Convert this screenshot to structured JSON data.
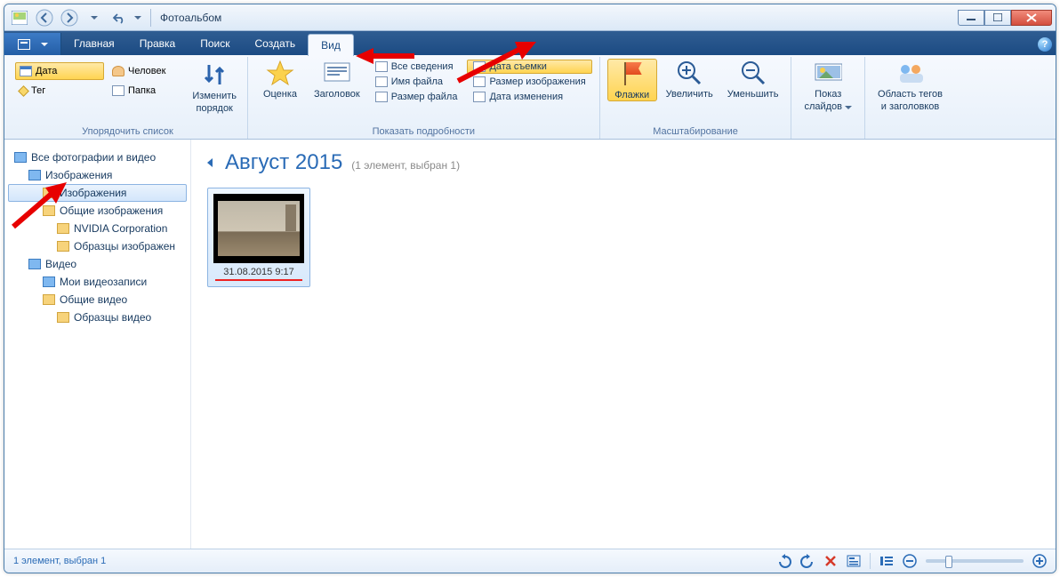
{
  "window": {
    "title": "Фотоальбом"
  },
  "tabs": {
    "file": "",
    "items": [
      "Главная",
      "Правка",
      "Поиск",
      "Создать",
      "Вид"
    ],
    "activeIndex": 4
  },
  "ribbon": {
    "sort": {
      "label": "Упорядочить список",
      "chips": {
        "date": "Дата",
        "tag": "Тег",
        "person": "Человек",
        "folder": "Папка"
      }
    },
    "change_order": {
      "line1": "Изменить",
      "line2": "порядок"
    },
    "rating_label": "Оценка",
    "caption_label": "Заголовок",
    "details": {
      "label": "Показать подробности",
      "all": "Все сведения",
      "filename": "Имя файла",
      "filesize": "Размер файла",
      "shot_date": "Дата съемки",
      "img_size": "Размер изображения",
      "modified": "Дата изменения"
    },
    "flags_label": "Флажки",
    "zoom_in": "Увеличить",
    "zoom_out": "Уменьшить",
    "zoom_label": "Масштабирование",
    "slideshow": {
      "line1": "Показ",
      "line2": "слайдов"
    },
    "tag_area": {
      "line1": "Область тегов",
      "line2": "и заголовков"
    }
  },
  "tree": {
    "root": "Все фотографии и видео",
    "images": "Изображения",
    "images_sub": "Изображения",
    "shared_images": "Общие изображения",
    "nvidia": "NVIDIA Corporation",
    "sample_images": "Образцы изображен",
    "video": "Видео",
    "my_videos": "Мои видеозаписи",
    "shared_video": "Общие видео",
    "sample_video": "Образцы видео"
  },
  "main": {
    "heading": "Август 2015",
    "sub": "(1 элемент, выбран 1)",
    "thumb_caption": "31.08.2015 9:17"
  },
  "status": {
    "text": "1 элемент, выбран 1"
  }
}
